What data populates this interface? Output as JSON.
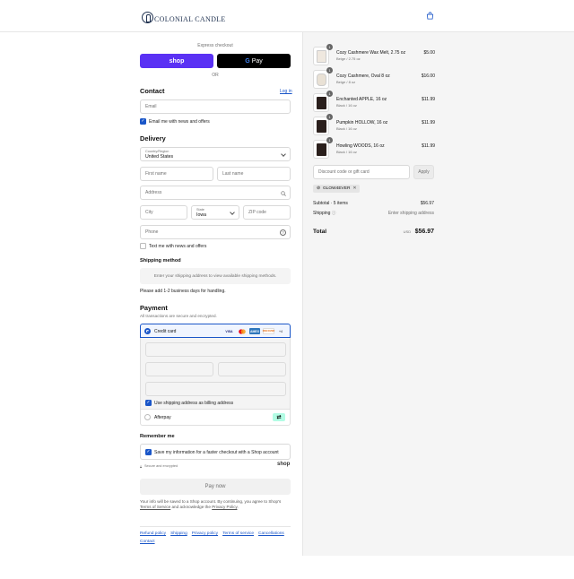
{
  "brand": {
    "name": "Colonial Candle"
  },
  "header": {
    "cart_icon": "shopping-bag-icon"
  },
  "express": {
    "title": "Express checkout",
    "shop_label": "shop",
    "gpay_g": "G",
    "gpay_label": "Pay",
    "or": "OR"
  },
  "contact": {
    "title": "Contact",
    "login_link": "Log in",
    "email_placeholder": "Email",
    "email_news_label": "Email me with news and offers",
    "email_news_checked": true
  },
  "delivery": {
    "title": "Delivery",
    "country_label": "Country/Region",
    "country_value": "United States",
    "first_name_placeholder": "First name",
    "last_name_placeholder": "Last name",
    "address_placeholder": "Address",
    "city_placeholder": "City",
    "state_label": "State",
    "state_value": "Iowa",
    "zip_placeholder": "ZIP code",
    "phone_placeholder": "Phone",
    "text_news_label": "Text me with news and offers",
    "text_news_checked": false
  },
  "shipping_method": {
    "title": "Shipping method",
    "info": "Enter your shipping address to view available shipping methods.",
    "note": "Please add 1-2 business days for handling."
  },
  "payment": {
    "title": "Payment",
    "subtitle": "All transactions are secure and encrypted.",
    "credit_card_label": "Credit card",
    "card_logos": [
      "VISA",
      "MC",
      "AMEX",
      "DISCOVER",
      "+4"
    ],
    "billing_label": "Use shipping address as billing address",
    "billing_checked": true,
    "afterpay_label": "Afterpay"
  },
  "remember": {
    "title": "Remember me",
    "save_label": "Save my information for a faster checkout with a Shop account",
    "save_checked": true,
    "secure_label": "Secure and encrypted",
    "shop_logo": "shop"
  },
  "pay_now_label": "Pay now",
  "legal": {
    "text_1": "Your info will be saved to a Shop account. By continuing, you agree to Shop's",
    "terms_link": "Terms of Service",
    "text_2": "and acknowledge the",
    "privacy_link": "Privacy Policy",
    "text_3": "."
  },
  "footer_links": [
    "Refund policy",
    "Shipping",
    "Privacy policy",
    "Terms of service",
    "Cancellations",
    "Contact"
  ],
  "cart": {
    "items": [
      {
        "name": "Cozy Cashmere Wax Melt, 2.75 oz",
        "variant": "Beige / 2.75 oz",
        "price": "$5.00",
        "qty": "1",
        "jar_color": "#efe8df"
      },
      {
        "name": "Cozy Cashmere, Oval 8 oz",
        "variant": "Beige / 8 oz",
        "price": "$16.00",
        "qty": "1",
        "jar_color": "#e9e1d5"
      },
      {
        "name": "Enchanted APPLE, 16 oz",
        "variant": "Black / 16 oz",
        "price": "$11.99",
        "qty": "1",
        "jar_color": "#2a1f1c"
      },
      {
        "name": "Pumpkin HOLLOW, 16 oz",
        "variant": "Black / 16 oz",
        "price": "$11.99",
        "qty": "1",
        "jar_color": "#2a1f1c"
      },
      {
        "name": "Howling WOODS, 16 oz",
        "variant": "Black / 16 oz",
        "price": "$11.99",
        "qty": "1",
        "jar_color": "#2a1f1c"
      }
    ],
    "discount_placeholder": "Discount code or gift card",
    "apply_label": "Apply",
    "applied_code": "GLOW4EVER",
    "subtotal_label": "Subtotal · 5 items",
    "subtotal_value": "$56.97",
    "shipping_label": "Shipping",
    "shipping_value": "Enter shipping address",
    "total_label": "Total",
    "currency": "USD",
    "total_value": "$56.97"
  },
  "colors": {
    "accent": "#1a56c8",
    "shop_purple": "#5a31f4",
    "afterpay_mint": "#b2fce4"
  }
}
